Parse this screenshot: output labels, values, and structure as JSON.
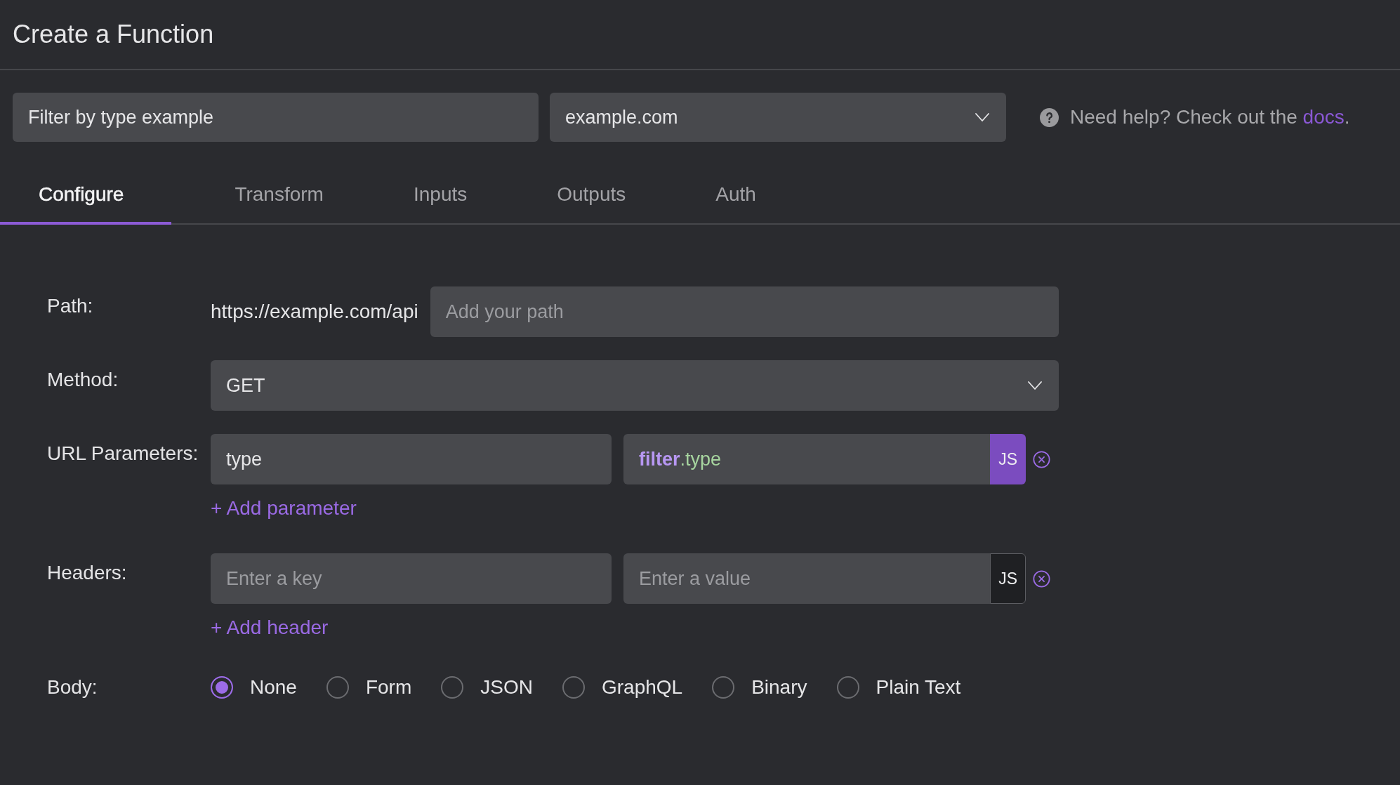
{
  "title": "Create a Function",
  "toolbar": {
    "filter": {
      "value": "Filter by type example"
    },
    "domain": {
      "value": "example.com"
    },
    "help": {
      "text": "Need help? Check out the ",
      "link": "docs",
      "after": "."
    }
  },
  "tabs": [
    {
      "label": "Configure",
      "selected": true
    },
    {
      "label": "Transform",
      "selected": false
    },
    {
      "label": "Inputs",
      "selected": false
    },
    {
      "label": "Outputs",
      "selected": false
    },
    {
      "label": "Auth",
      "selected": false
    }
  ],
  "form": {
    "path": {
      "label": "Path:",
      "prefix": "https://example.com/api",
      "placeholder": "Add your path"
    },
    "method": {
      "label": "Method:",
      "value": "GET"
    },
    "url_parameters": {
      "label": "URL Parameters:",
      "rows": [
        {
          "key": {
            "value": "type"
          },
          "value": {
            "tokens": [
              {
                "text": "filter",
                "kind": "object"
              },
              {
                "text": ".type",
                "kind": "property"
              }
            ]
          },
          "js": {
            "label": "JS",
            "on": true
          }
        }
      ],
      "add_link": "+ Add parameter"
    },
    "headers": {
      "label": "Headers:",
      "rows": [
        {
          "key": {
            "placeholder": "Enter a key"
          },
          "value": {
            "placeholder": "Enter a value"
          },
          "js": {
            "label": "JS",
            "on": false
          }
        }
      ],
      "add_link": "+ Add header"
    },
    "body": {
      "label": "Body:",
      "options": [
        {
          "label": "None",
          "selected": true
        },
        {
          "label": "Form",
          "selected": false
        },
        {
          "label": "JSON",
          "selected": false
        },
        {
          "label": "GraphQL",
          "selected": false
        },
        {
          "label": "Binary",
          "selected": false
        },
        {
          "label": "Plain Text",
          "selected": false
        }
      ]
    }
  }
}
